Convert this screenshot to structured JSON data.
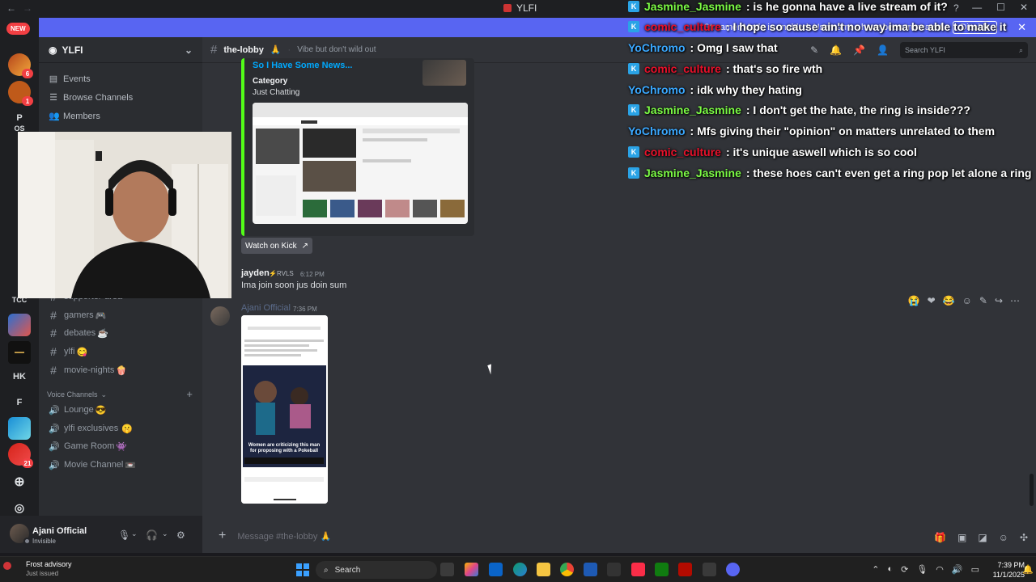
{
  "window": {
    "title": "YLFI",
    "minimize_icon": "minimize-icon",
    "maximize_icon": "maximize-icon",
    "close_icon": "close-icon"
  },
  "banner": {
    "text": "Streamer Mode is enabled. Usernames have been truncated.",
    "disable_label": "Disable"
  },
  "rail": {
    "new_label": "NEW",
    "guilds": [
      {
        "label": "",
        "badge": "6"
      },
      {
        "label": "",
        "badge": "1"
      },
      {
        "label": "P",
        "badge": ""
      },
      {
        "label": "OS",
        "badge": ""
      },
      {
        "label": "TCC",
        "badge": ""
      },
      {
        "label": "",
        "badge": ""
      },
      {
        "label": "",
        "badge": ""
      },
      {
        "label": "HK",
        "badge": ""
      },
      {
        "label": "F",
        "badge": ""
      },
      {
        "label": "",
        "badge": ""
      },
      {
        "label": "",
        "badge": "21"
      }
    ]
  },
  "server": {
    "name": "YLFI"
  },
  "nav": {
    "events": "Events",
    "browse": "Browse Channels",
    "members": "Members"
  },
  "text_channels": [
    {
      "name": "supporter-area",
      "emoji": ""
    },
    {
      "name": "gamers",
      "emoji": "🎮"
    },
    {
      "name": "debates",
      "emoji": "☕"
    },
    {
      "name": "ylfi",
      "emoji": "😋"
    },
    {
      "name": "movie-nights",
      "emoji": "🍿"
    }
  ],
  "voice_category": "Voice Channels",
  "voice_channels": [
    {
      "name": "Lounge",
      "emoji": "😎"
    },
    {
      "name": "ylfi exclusives",
      "emoji": "🤫"
    },
    {
      "name": "Game Room",
      "emoji": "👾"
    },
    {
      "name": "Movie Channel",
      "emoji": "📼"
    }
  ],
  "user": {
    "name": "Ajani Official",
    "status": "Invisible"
  },
  "channel": {
    "name": "the-lobby",
    "emoji": "🙏",
    "topic": "Vibe but don't wild out",
    "search_placeholder": "Search YLFI"
  },
  "embed": {
    "title": "So I Have Some News...",
    "field_name": "Category",
    "field_value": "Just Chatting",
    "watch_label": "Watch on Kick"
  },
  "messages": [
    {
      "author": "jayden",
      "role": "RVLS",
      "time": "6:12 PM",
      "text": "Ima join soon jus doin sum"
    },
    {
      "author": "Ajani Official",
      "time": "7:36 PM",
      "image_caption": "Women are criticizing this man for proposing with a Pokeball"
    }
  ],
  "composer": {
    "placeholder": "Message #the-lobby 🙏"
  },
  "overlay": [
    {
      "user": "Jasmine_Jasmine",
      "color": "#7cfc45",
      "kick": true,
      "text": ": is he gonna have a live stream of it?"
    },
    {
      "user": "comic_culture",
      "color": "#e8102a",
      "kick": true,
      "text": ": I hope so cause ain't no way ima be able to make it"
    },
    {
      "user": "YoChromo",
      "color": "#3aa8ff",
      "kick": false,
      "text": ": Omg I saw that"
    },
    {
      "user": "comic_culture",
      "color": "#e8102a",
      "kick": true,
      "text": ": that's so fire wth"
    },
    {
      "user": "YoChromo",
      "color": "#3aa8ff",
      "kick": false,
      "text": ": idk why they hating"
    },
    {
      "user": "Jasmine_Jasmine",
      "color": "#7cfc45",
      "kick": true,
      "text": ": I don't get the hate, the ring is inside???"
    },
    {
      "user": "YoChromo",
      "color": "#3aa8ff",
      "kick": false,
      "text": ": Mfs giving their \"opinion\" on matters unrelated to them"
    },
    {
      "user": "comic_culture",
      "color": "#e8102a",
      "kick": true,
      "text": ": it's unique aswell which is so cool"
    },
    {
      "user": "Jasmine_Jasmine",
      "color": "#7cfc45",
      "kick": true,
      "text": ": these hoes can't even get a ring pop let alone a ring"
    }
  ],
  "taskbar": {
    "weather_title": "Frost advisory",
    "weather_sub": "Just issued",
    "search_label": "Search",
    "time": "7:39 PM",
    "date": "11/1/2025"
  },
  "colors": {
    "accent": "#5865f2",
    "kick_green": "#53fc18",
    "link": "#00a8fc"
  }
}
